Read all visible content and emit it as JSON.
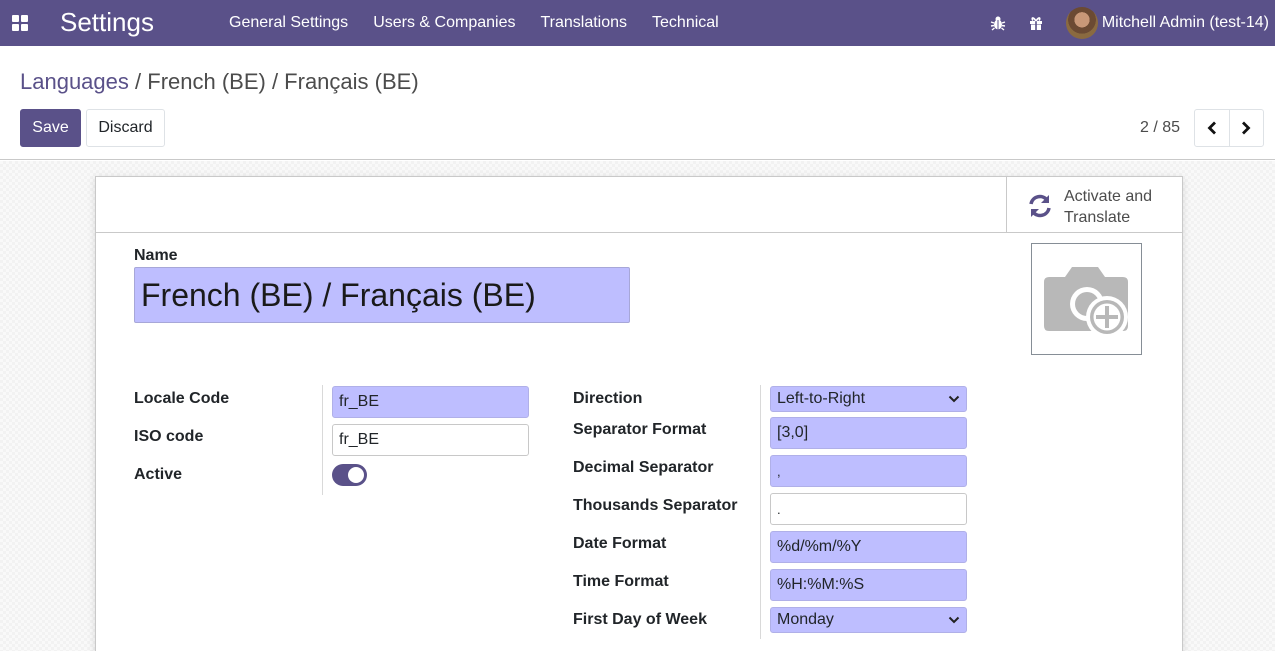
{
  "navbar": {
    "app_title": "Settings",
    "menu": [
      {
        "label": "General Settings"
      },
      {
        "label": "Users & Companies"
      },
      {
        "label": "Translations"
      },
      {
        "label": "Technical"
      }
    ],
    "icons": [
      "apps-icon",
      "bug-icon",
      "gift-icon"
    ],
    "user_name": "Mitchell Admin (test-14)",
    "brand_color": "#5a5189"
  },
  "control_panel": {
    "breadcrumb": {
      "parent": "Languages",
      "separator": "/",
      "current": "French (BE) / Français (BE)"
    },
    "save_label": "Save",
    "discard_label": "Discard",
    "pager": {
      "value": "2 / 85",
      "prev_icon": "chevron-left-icon",
      "next_icon": "chevron-right-icon"
    }
  },
  "form": {
    "stat_button": {
      "icon": "refresh-icon",
      "label": "Activate and Translate"
    },
    "image_placeholder_icon": "camera-add-icon",
    "name_label": "Name",
    "name_value": "French (BE) / Français (BE)",
    "left_group": {
      "locale_code": {
        "label": "Locale Code",
        "value": "fr_BE"
      },
      "iso_code": {
        "label": "ISO code",
        "value": "fr_BE"
      },
      "active": {
        "label": "Active",
        "value": true
      }
    },
    "right_group": {
      "direction": {
        "label": "Direction",
        "value": "Left-to-Right"
      },
      "separator_format": {
        "label": "Separator Format",
        "value": "[3,0]"
      },
      "decimal_separator": {
        "label": "Decimal Separator",
        "value": ","
      },
      "thousands_separator": {
        "label": "Thousands Separator",
        "value": "."
      },
      "date_format": {
        "label": "Date Format",
        "value": "%d/%m/%Y"
      },
      "time_format": {
        "label": "Time Format",
        "value": "%H:%M:%S"
      },
      "first_day_of_week": {
        "label": "First Day of Week",
        "value": "Monday"
      }
    },
    "required_field_color": "#bebeff"
  }
}
